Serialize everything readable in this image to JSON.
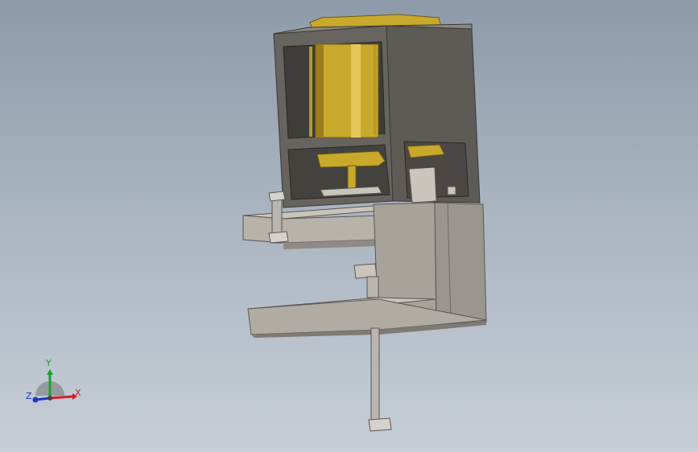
{
  "viewport": {
    "background_top": "#8d9aa9",
    "background_bottom": "#c7ced6"
  },
  "model": {
    "colors": {
      "frame": "#676460",
      "frame_dark": "#4b4845",
      "frame_light": "#8a8782",
      "motor_gold": "#c9a92c",
      "motor_gold_light": "#e3c65a",
      "clamp_light": "#c9c4bc",
      "clamp_mid": "#a7a29a",
      "clamp_dark": "#7f7a73",
      "screw": "#b9b6b1"
    }
  },
  "triad": {
    "x_label": "X",
    "y_label": "Y",
    "z_label": "Z",
    "x_color": "#d21f1f",
    "y_color": "#1aa02a",
    "z_color": "#2036c8"
  }
}
